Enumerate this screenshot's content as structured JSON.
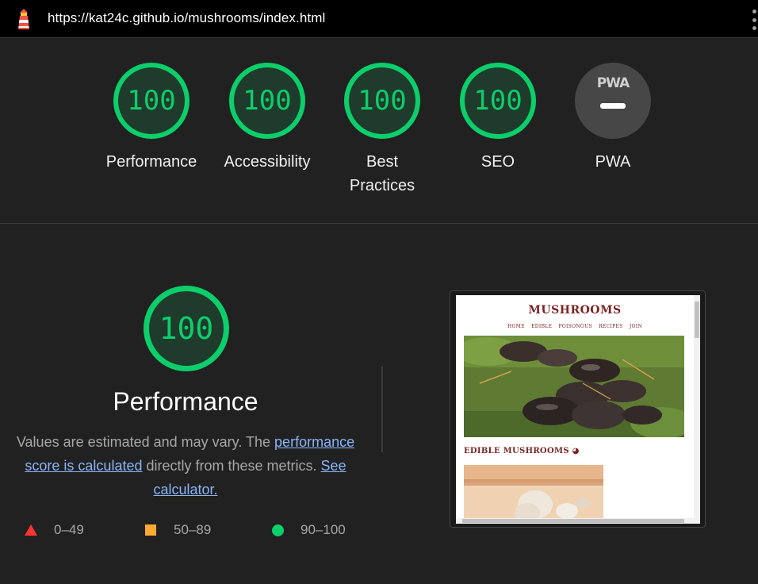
{
  "topbar": {
    "url": "https://kat24c.github.io/mushrooms/index.html",
    "logo_icon": "lighthouse-icon",
    "menu_icon": "more-vert-icon"
  },
  "colors": {
    "pass": "#0cce6b",
    "average": "#ffaa33",
    "fail": "#ff3333",
    "link": "#8ab4f8"
  },
  "scores": [
    {
      "label": "Performance",
      "score": "100"
    },
    {
      "label": "Accessibility",
      "score": "100"
    },
    {
      "label": "Best Practices",
      "score": "100"
    },
    {
      "label": "SEO",
      "score": "100"
    }
  ],
  "pwa": {
    "badge_text": "PWA",
    "label": "PWA",
    "icon": "pwa-badge-icon"
  },
  "performance": {
    "score": "100",
    "title": "Performance",
    "desc_prefix": "Values are estimated and may vary. The ",
    "desc_link1": "performance score is calculated",
    "desc_middle": " directly from these metrics. ",
    "desc_link2": "See calculator."
  },
  "legend": [
    {
      "icon": "triangle-icon",
      "label": "0–49"
    },
    {
      "icon": "square-icon",
      "label": "50–89"
    },
    {
      "icon": "circle-icon",
      "label": "90–100"
    }
  ],
  "thumbnail": {
    "site_title": "MUSHROOMS",
    "nav": [
      "HOME",
      "EDIBLE",
      "POISONOUS",
      "RECIPES",
      "JOIN"
    ],
    "section_heading": "EDIBLE MUSHROOMS"
  }
}
